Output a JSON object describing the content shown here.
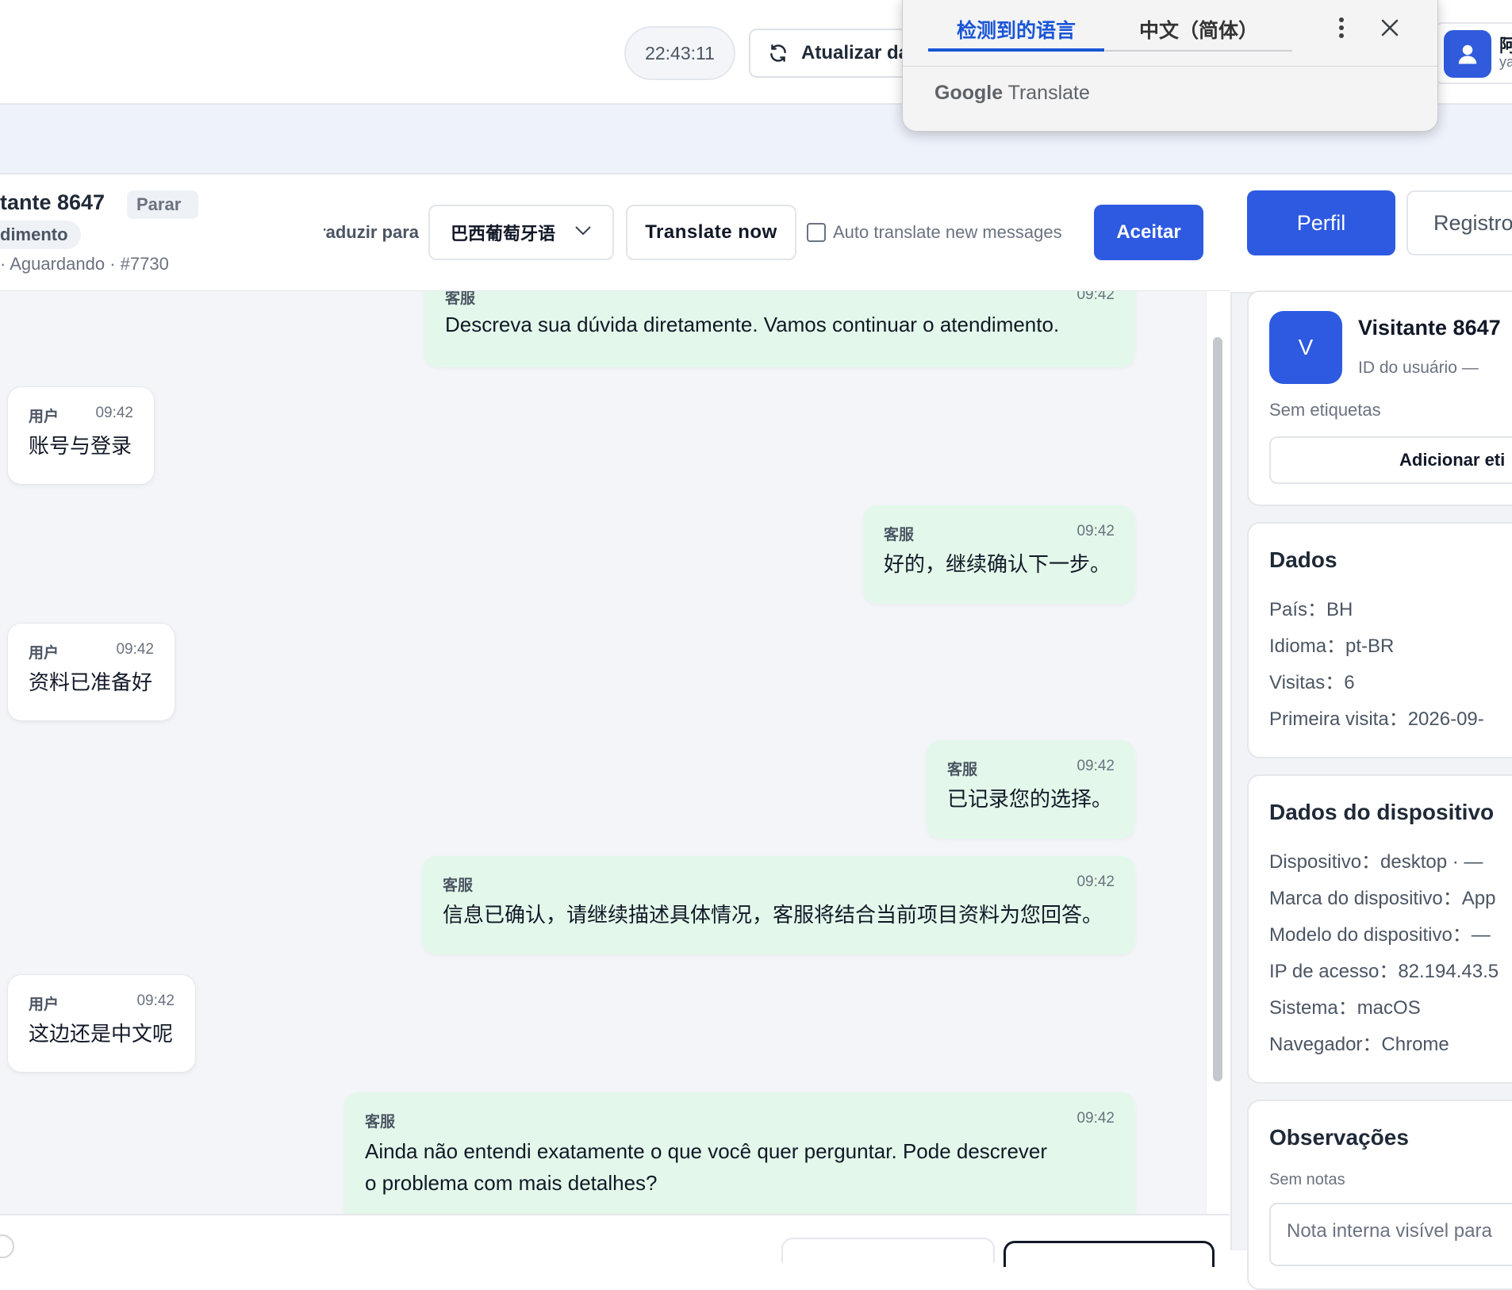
{
  "topbar": {
    "clock": "22:43:11",
    "refresh_label": "Atualizar da",
    "user_name": "阿",
    "user_sub": "ya"
  },
  "translate_popup": {
    "tab_detected": "检测到的语言",
    "tab_target": "中文（简体）",
    "brand_google": "Google",
    "brand_translate": "Translate"
  },
  "chat_header": {
    "title": "tante 8647",
    "parar_badge": "Parar",
    "attend_badge": "dimento",
    "status_line": "· Aguardando · #7730",
    "translate_label": "Traduzir para",
    "language_selected": "巴西葡萄牙语",
    "translate_now": "Translate now",
    "auto_translate": "Auto translate new messages",
    "accept": "Aceitar"
  },
  "messages": [
    {
      "role": "agent",
      "sender": "客服",
      "time": "09:42",
      "text": "Descreva sua dúvida diretamente. Vamos continuar o atendimento."
    },
    {
      "role": "user",
      "sender": "用户",
      "time": "09:42",
      "text": "账号与登录"
    },
    {
      "role": "agent",
      "sender": "客服",
      "time": "09:42",
      "text": "好的，继续确认下一步。"
    },
    {
      "role": "user",
      "sender": "用户",
      "time": "09:42",
      "text": "资料已准备好"
    },
    {
      "role": "agent",
      "sender": "客服",
      "time": "09:42",
      "text": "已记录您的选择。"
    },
    {
      "role": "agent",
      "sender": "客服",
      "time": "09:42",
      "text": "信息已确认，请继续描述具体情况，客服将结合当前项目资料为您回答。"
    },
    {
      "role": "user",
      "sender": "用户",
      "time": "09:42",
      "text": "这边还是中文呢"
    },
    {
      "role": "agent",
      "sender": "客服",
      "time": "09:42",
      "text_line1": "Ainda não entendi exatamente o que você quer perguntar. Pode descrever",
      "text_line2": "o problema com mais detalhes?"
    }
  ],
  "right_panel": {
    "tab_profile": "Perfil",
    "tab_record": "Registro",
    "avatar_letter": "V",
    "visitor_name": "Visitante 8647",
    "visitor_id": "ID do usuário —",
    "no_tags": "Sem etiquetas",
    "add_tag": "Adicionar eti",
    "data_title": "Dados",
    "data_rows": [
      "País：BH",
      "Idioma：pt-BR",
      "Visitas：6",
      "Primeira visita：2026-09-"
    ],
    "device_title": "Dados do dispositivo",
    "device_rows": [
      "Dispositivo：desktop · —",
      "Marca do dispositivo：App",
      "Modelo do dispositivo：—",
      "IP de acesso：82.194.43.5",
      "Sistema：macOS",
      "Navegador：Chrome"
    ],
    "notes_title": "Observações",
    "no_notes": "Sem notas",
    "note_placeholder": "Nota interna visível para"
  },
  "colors": {
    "accent": "#2d5ae0",
    "agent_bubble": "#e3f8ea",
    "chat_bg": "#f3f5f9",
    "popup_tab_active": "#1a56d6"
  },
  "icons": [
    "refresh-icon",
    "user-icon",
    "more-vert-icon",
    "close-icon",
    "chevron-down-icon"
  ]
}
